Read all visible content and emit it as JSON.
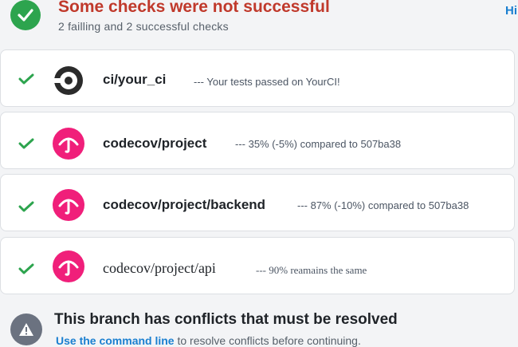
{
  "header": {
    "title": "Some checks were not successful",
    "subtitle": "2 failling and 2 successful checks",
    "hide_link": "Hi"
  },
  "checks": [
    {
      "name": "ci/your_ci",
      "description": "--- Your tests passed on YourCI!",
      "logo": "circleci-logo",
      "status": "success"
    },
    {
      "name": "codecov/project",
      "description": "--- 35% (-5%) compared to 507ba38",
      "logo": "codecov-umbrella-logo",
      "status": "success"
    },
    {
      "name": "codecov/project/backend",
      "description": "--- 87% (-10%) compared to 507ba38",
      "logo": "codecov-umbrella-logo",
      "status": "success"
    },
    {
      "name": "codecov/project/api",
      "description": "--- 90% reamains the same",
      "logo": "codecov-umbrella-logo",
      "status": "success"
    }
  ],
  "conflict": {
    "title": "This branch has conflicts that must be resolved",
    "link": "Use the command line",
    "text": " to resolve conflicts before continuing."
  },
  "colors": {
    "success": "#2da44e",
    "failure_title": "#c0392b",
    "link": "#1a7fd0",
    "codecov": "#f01f7a",
    "warning_icon": "#6b7280"
  }
}
